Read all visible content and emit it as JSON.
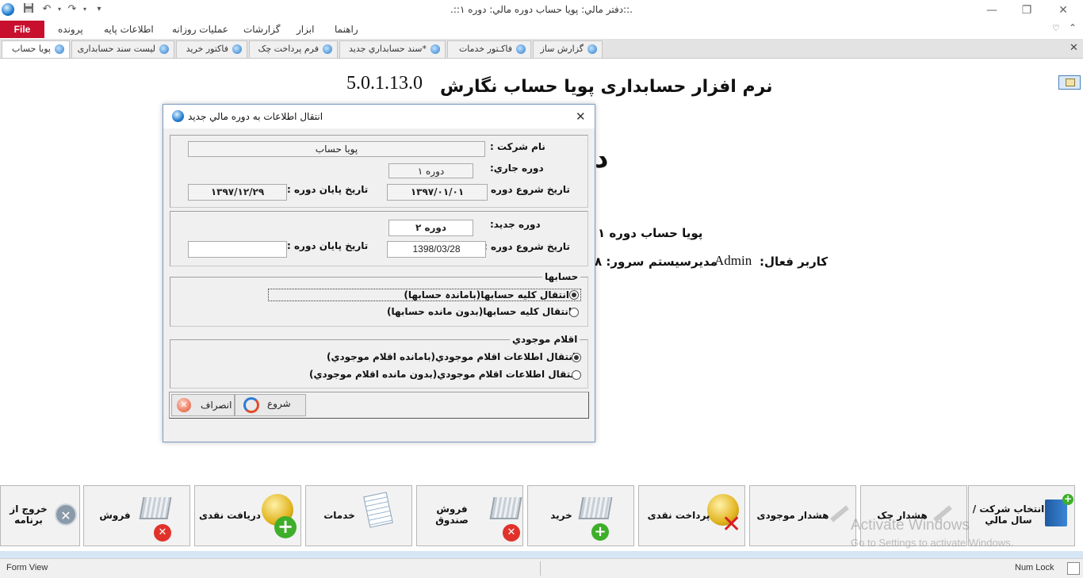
{
  "window": {
    "title": ".::دفتر مالي: پویا حساب دوره مالي: دوره ۱::.",
    "minimize": "—",
    "restore": "❐",
    "close": "✕"
  },
  "ribbon": {
    "file_label": "File",
    "menu": [
      "پرونده",
      "اطلاعات پایه",
      "عملیات روزانه",
      "گزارشات",
      "ابزار",
      "راهنما"
    ]
  },
  "tabs": [
    {
      "label": "پویا حساب",
      "active": true
    },
    {
      "label": "لیست سند حسابداری",
      "active": false
    },
    {
      "label": "فاکتور خرید",
      "active": false
    },
    {
      "label": "فرم  پرداخت چک",
      "active": false
    },
    {
      "label": "*سند حسابداري جدید",
      "active": false
    },
    {
      "label": "فاکـتور خدمات",
      "active": false
    },
    {
      "label": "گزارش ساز",
      "active": false
    }
  ],
  "background": {
    "app_title": "نرم افزار حسابداری پویا حساب نگارش",
    "version": "5.0.1.13.0",
    "big_char": "د",
    "company_period": "پویا حساب  دوره ۱",
    "user_label": "کاربر فعال:",
    "user_name": "Admin",
    "user_role": "مدیرسیستم",
    "server_label": "سرور: ۸"
  },
  "dialog": {
    "title": "انتقال اطلاعات به دوره مالي جدید",
    "current": {
      "company_label": "نام شرکت :",
      "company_value": "پویا حساب",
      "period_label": "دوره جاري:",
      "period_value": "دوره ۱",
      "start_label": "تاریخ شروع دوره :",
      "start_value": "۱۳۹۷/۰۱/۰۱",
      "end_label": "تاریخ پایان دوره :",
      "end_value": "۱۳۹۷/۱۲/۲۹"
    },
    "new": {
      "period_label": "دوره جدید:",
      "period_value": "دوره ۲",
      "start_label": "تاریخ شروع دوره :",
      "start_value": "1398/03/28",
      "end_label": "تاریخ پایان دوره :",
      "end_value": ""
    },
    "accounts": {
      "title": "حسابها",
      "options": [
        "انتقال کلیه حسابها(باماندہ حسابها)",
        "انتقال کلیه حسابها(بدون مانده حسابها)"
      ],
      "selected": 0
    },
    "inventory": {
      "title": "اقلام موجودي",
      "options": [
        "انتقال اطلاعات اقلام موجودي(بامانده اقلام موجودي)",
        "انتقال اطلاعات اقلام موجودي(بدون مانده اقلام موجودي)"
      ],
      "selected": 0
    },
    "buttons": {
      "start": "شروع",
      "cancel": "انصراف"
    }
  },
  "shortcuts": [
    {
      "label": "انتخاب شرکت /\nسال مالي",
      "icon": "book-icon"
    },
    {
      "label": "هشدار چک",
      "icon": "pen-icon"
    },
    {
      "label": "هشدار موجودی",
      "icon": "pen-icon"
    },
    {
      "label": "پرداخت نقدی",
      "icon": "coin-remove-icon"
    },
    {
      "label": "خرید",
      "icon": "cart-add-icon"
    },
    {
      "label": "فروش\nصندوق",
      "icon": "cart-remove-icon"
    },
    {
      "label": "خدمات",
      "icon": "document-icon"
    },
    {
      "label": "دریافت نقدی",
      "icon": "coin-add-icon"
    },
    {
      "label": "فروش",
      "icon": "cart-remove-icon"
    },
    {
      "label": "خروج از\nبرنامه",
      "icon": "exit-icon"
    }
  ],
  "watermark": {
    "line1": "Activate Windows",
    "line2": "Go to Settings to activate Windows."
  },
  "statusbar": {
    "left": "Form View",
    "right": "Num Lock"
  },
  "colors": {
    "file_tab": "#c8102e",
    "dialog_border": "#7a9cc4",
    "status_band": "#d6e6f5"
  }
}
